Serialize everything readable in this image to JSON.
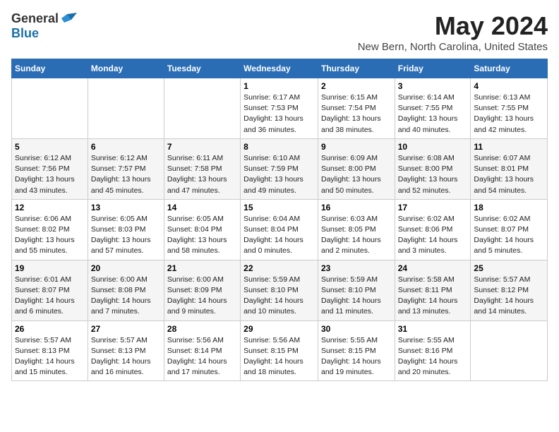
{
  "logo": {
    "general": "General",
    "blue": "Blue"
  },
  "title": {
    "month_year": "May 2024",
    "location": "New Bern, North Carolina, United States"
  },
  "headers": [
    "Sunday",
    "Monday",
    "Tuesday",
    "Wednesday",
    "Thursday",
    "Friday",
    "Saturday"
  ],
  "weeks": [
    [
      {
        "day": "",
        "info": ""
      },
      {
        "day": "",
        "info": ""
      },
      {
        "day": "",
        "info": ""
      },
      {
        "day": "1",
        "info": "Sunrise: 6:17 AM\nSunset: 7:53 PM\nDaylight: 13 hours\nand 36 minutes."
      },
      {
        "day": "2",
        "info": "Sunrise: 6:15 AM\nSunset: 7:54 PM\nDaylight: 13 hours\nand 38 minutes."
      },
      {
        "day": "3",
        "info": "Sunrise: 6:14 AM\nSunset: 7:55 PM\nDaylight: 13 hours\nand 40 minutes."
      },
      {
        "day": "4",
        "info": "Sunrise: 6:13 AM\nSunset: 7:55 PM\nDaylight: 13 hours\nand 42 minutes."
      }
    ],
    [
      {
        "day": "5",
        "info": "Sunrise: 6:12 AM\nSunset: 7:56 PM\nDaylight: 13 hours\nand 43 minutes."
      },
      {
        "day": "6",
        "info": "Sunrise: 6:12 AM\nSunset: 7:57 PM\nDaylight: 13 hours\nand 45 minutes."
      },
      {
        "day": "7",
        "info": "Sunrise: 6:11 AM\nSunset: 7:58 PM\nDaylight: 13 hours\nand 47 minutes."
      },
      {
        "day": "8",
        "info": "Sunrise: 6:10 AM\nSunset: 7:59 PM\nDaylight: 13 hours\nand 49 minutes."
      },
      {
        "day": "9",
        "info": "Sunrise: 6:09 AM\nSunset: 8:00 PM\nDaylight: 13 hours\nand 50 minutes."
      },
      {
        "day": "10",
        "info": "Sunrise: 6:08 AM\nSunset: 8:00 PM\nDaylight: 13 hours\nand 52 minutes."
      },
      {
        "day": "11",
        "info": "Sunrise: 6:07 AM\nSunset: 8:01 PM\nDaylight: 13 hours\nand 54 minutes."
      }
    ],
    [
      {
        "day": "12",
        "info": "Sunrise: 6:06 AM\nSunset: 8:02 PM\nDaylight: 13 hours\nand 55 minutes."
      },
      {
        "day": "13",
        "info": "Sunrise: 6:05 AM\nSunset: 8:03 PM\nDaylight: 13 hours\nand 57 minutes."
      },
      {
        "day": "14",
        "info": "Sunrise: 6:05 AM\nSunset: 8:04 PM\nDaylight: 13 hours\nand 58 minutes."
      },
      {
        "day": "15",
        "info": "Sunrise: 6:04 AM\nSunset: 8:04 PM\nDaylight: 14 hours\nand 0 minutes."
      },
      {
        "day": "16",
        "info": "Sunrise: 6:03 AM\nSunset: 8:05 PM\nDaylight: 14 hours\nand 2 minutes."
      },
      {
        "day": "17",
        "info": "Sunrise: 6:02 AM\nSunset: 8:06 PM\nDaylight: 14 hours\nand 3 minutes."
      },
      {
        "day": "18",
        "info": "Sunrise: 6:02 AM\nSunset: 8:07 PM\nDaylight: 14 hours\nand 5 minutes."
      }
    ],
    [
      {
        "day": "19",
        "info": "Sunrise: 6:01 AM\nSunset: 8:07 PM\nDaylight: 14 hours\nand 6 minutes."
      },
      {
        "day": "20",
        "info": "Sunrise: 6:00 AM\nSunset: 8:08 PM\nDaylight: 14 hours\nand 7 minutes."
      },
      {
        "day": "21",
        "info": "Sunrise: 6:00 AM\nSunset: 8:09 PM\nDaylight: 14 hours\nand 9 minutes."
      },
      {
        "day": "22",
        "info": "Sunrise: 5:59 AM\nSunset: 8:10 PM\nDaylight: 14 hours\nand 10 minutes."
      },
      {
        "day": "23",
        "info": "Sunrise: 5:59 AM\nSunset: 8:10 PM\nDaylight: 14 hours\nand 11 minutes."
      },
      {
        "day": "24",
        "info": "Sunrise: 5:58 AM\nSunset: 8:11 PM\nDaylight: 14 hours\nand 13 minutes."
      },
      {
        "day": "25",
        "info": "Sunrise: 5:57 AM\nSunset: 8:12 PM\nDaylight: 14 hours\nand 14 minutes."
      }
    ],
    [
      {
        "day": "26",
        "info": "Sunrise: 5:57 AM\nSunset: 8:13 PM\nDaylight: 14 hours\nand 15 minutes."
      },
      {
        "day": "27",
        "info": "Sunrise: 5:57 AM\nSunset: 8:13 PM\nDaylight: 14 hours\nand 16 minutes."
      },
      {
        "day": "28",
        "info": "Sunrise: 5:56 AM\nSunset: 8:14 PM\nDaylight: 14 hours\nand 17 minutes."
      },
      {
        "day": "29",
        "info": "Sunrise: 5:56 AM\nSunset: 8:15 PM\nDaylight: 14 hours\nand 18 minutes."
      },
      {
        "day": "30",
        "info": "Sunrise: 5:55 AM\nSunset: 8:15 PM\nDaylight: 14 hours\nand 19 minutes."
      },
      {
        "day": "31",
        "info": "Sunrise: 5:55 AM\nSunset: 8:16 PM\nDaylight: 14 hours\nand 20 minutes."
      },
      {
        "day": "",
        "info": ""
      }
    ]
  ]
}
